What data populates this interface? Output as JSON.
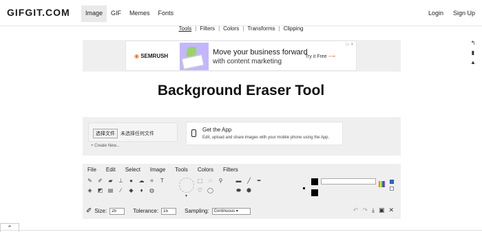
{
  "header": {
    "logo": "GIFGIT.COM",
    "nav": [
      "Image",
      "GIF",
      "Memes",
      "Fonts"
    ],
    "login": "Login",
    "signup": "Sign Up"
  },
  "subnav": [
    "Tools",
    "Filters",
    "Colors",
    "Transforms",
    "Clipping"
  ],
  "ad": {
    "brand": "SEMRUSH",
    "headline": "Move your business forward",
    "subline": "with content marketing",
    "cta": "Try it Free",
    "cta_arrow": "⟶"
  },
  "page_title": "Background Eraser Tool",
  "upload": {
    "choose_label": "选择文件",
    "no_file": "未选择任何文件",
    "create_new": "+ Create New..."
  },
  "app_promo": {
    "title": "Get the App",
    "desc": "Edit, upload and share images with your mobile phone using the App."
  },
  "editor": {
    "menu": [
      "File",
      "Edit",
      "Select",
      "Image",
      "Tools",
      "Colors",
      "Filters"
    ],
    "size_label": "Size:",
    "size_value": "25",
    "tolerance_label": "Tolerance:",
    "tolerance_value": "15",
    "sampling_label": "Sampling:",
    "sampling_value": "Continuous"
  }
}
